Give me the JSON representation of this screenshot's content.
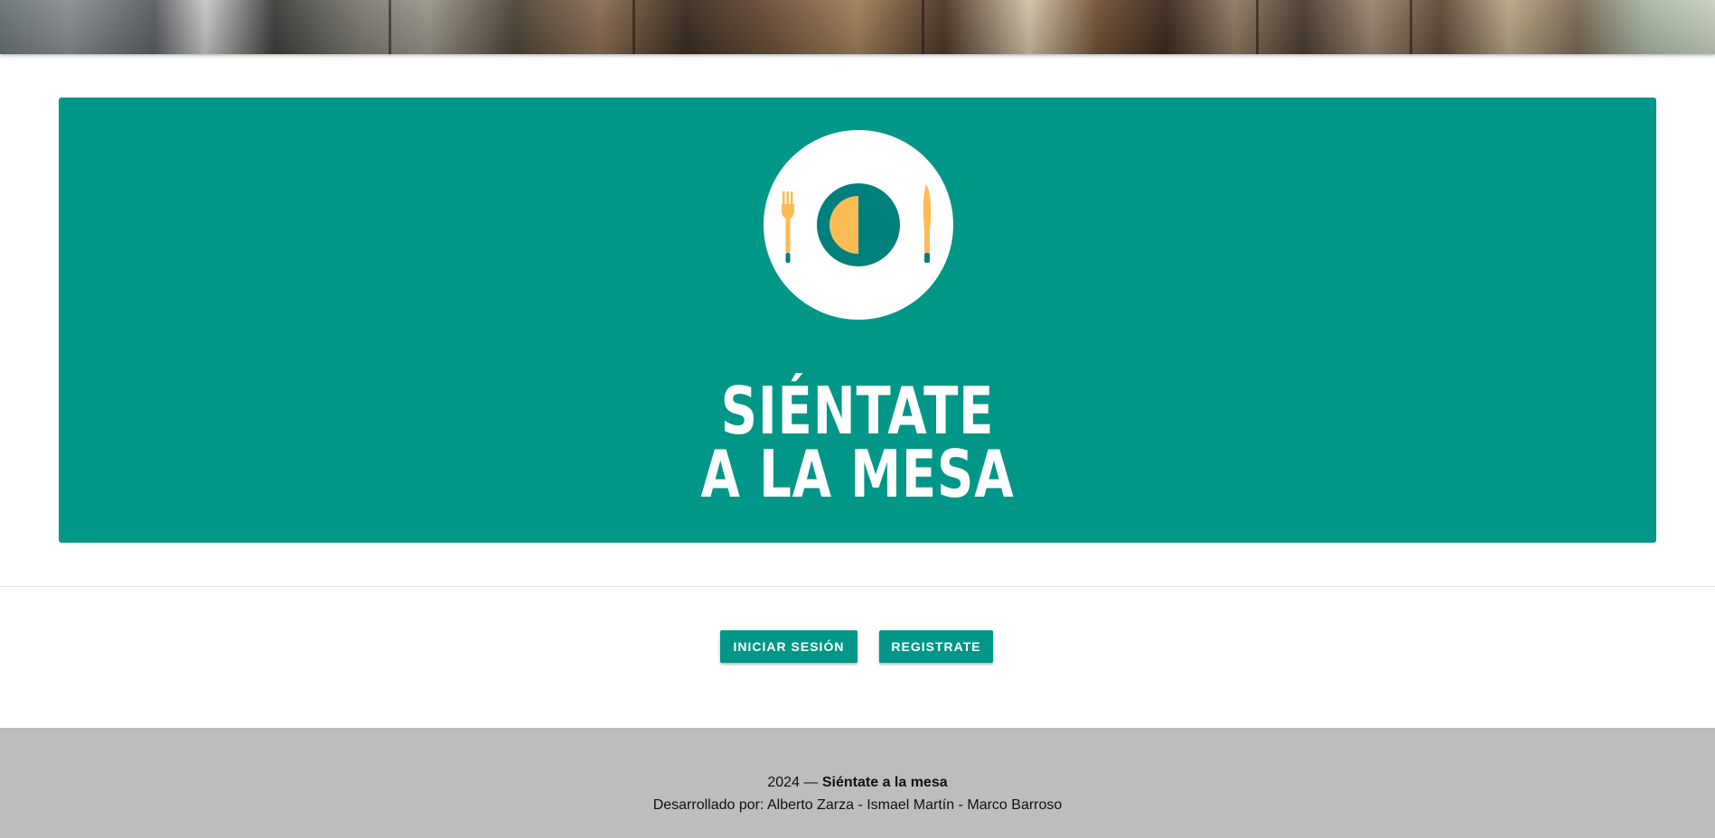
{
  "banner": {
    "image": "restaurant-interior-photo"
  },
  "hero": {
    "logo": "plate-fork-knife-icon",
    "title_line1": "Siéntate",
    "title_line2": "a la Mesa",
    "colors": {
      "background": "#009688",
      "plate": "#ffffff",
      "food": "#fbbc55",
      "dark": "#00807c"
    }
  },
  "actions": {
    "login_label": "INICIAR SESIÓN",
    "register_label": "REGISTRATE"
  },
  "footer": {
    "year_prefix": "2024 —",
    "site_name": "Siéntate a la mesa",
    "credits": "Desarrollado por: Alberto Zarza - Ismael Martín - Marco Barroso"
  }
}
